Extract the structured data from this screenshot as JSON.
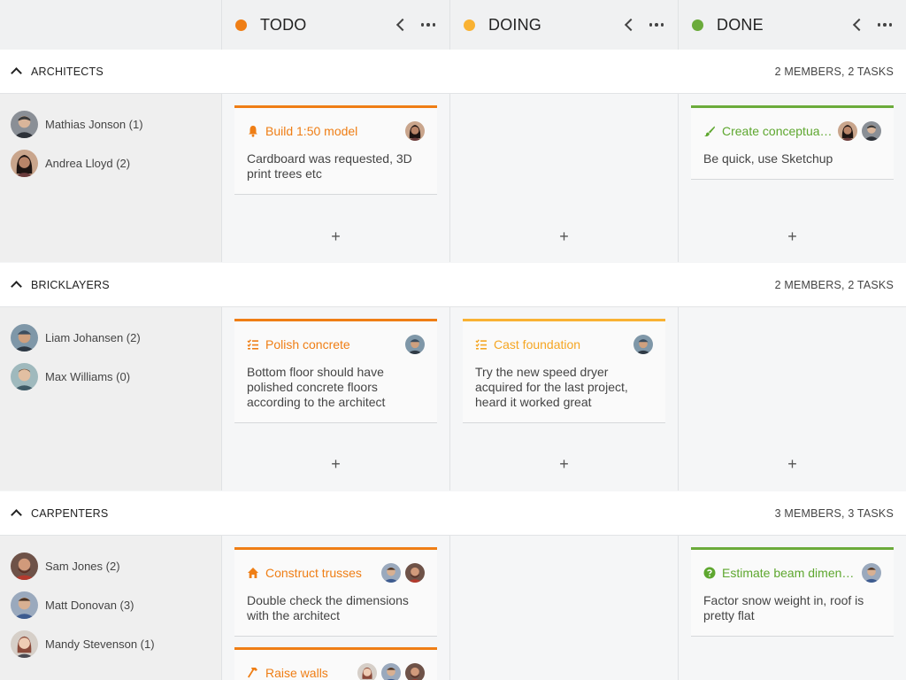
{
  "columns": [
    {
      "title": "TODO",
      "color": "#ef7e15"
    },
    {
      "title": "DOING",
      "color": "#f9b233"
    },
    {
      "title": "DONE",
      "color": "#6bab3b"
    }
  ],
  "groups": [
    {
      "name": "ARCHITECTS",
      "count": "2 MEMBERS, 2 TASKS",
      "members": [
        {
          "name": "Mathias Jonson (1)",
          "avatar": "man-grey"
        },
        {
          "name": "Andrea Lloyd (2)",
          "avatar": "woman-dark"
        }
      ],
      "cards": {
        "todo": [
          {
            "title": "Build 1:50 model",
            "icon": "bell-icon",
            "text": "Cardboard was requested, 3D print trees etc",
            "avatars": [
              "woman-dark"
            ]
          }
        ],
        "done": [
          {
            "title": "Create conceptual...",
            "icon": "brush-icon",
            "text": "Be quick, use Sketchup",
            "avatars": [
              "woman-dark",
              "man-grey"
            ]
          }
        ]
      }
    },
    {
      "name": "BRICKLAYERS",
      "count": "2 MEMBERS, 2 TASKS",
      "members": [
        {
          "name": "Liam Johansen (2)",
          "avatar": "man-cap"
        },
        {
          "name": "Max Williams (0)",
          "avatar": "man-young"
        }
      ],
      "cards": {
        "todo": [
          {
            "title": "Polish concrete",
            "icon": "checklist-icon",
            "text": "Bottom floor should have polished concrete floors according to the architect",
            "avatars": [
              "man-cap"
            ]
          }
        ],
        "doing": [
          {
            "title": "Cast foundation",
            "icon": "checklist-icon",
            "text": "Try the new speed dryer acquired for the last project, heard it worked great",
            "avatars": [
              "man-cap"
            ]
          }
        ]
      }
    },
    {
      "name": "CARPENTERS",
      "count": "3 MEMBERS, 3 TASKS",
      "members": [
        {
          "name": "Sam Jones (2)",
          "avatar": "man-red"
        },
        {
          "name": "Matt Donovan (3)",
          "avatar": "man-blue"
        },
        {
          "name": "Mandy Stevenson (1)",
          "avatar": "woman-light"
        }
      ],
      "cards": {
        "todo": [
          {
            "title": "Construct trusses",
            "icon": "house-icon",
            "text": "Double check the dimensions with the architect",
            "avatars": [
              "man-blue",
              "man-red"
            ]
          },
          {
            "title": "Raise walls",
            "icon": "hammer-icon",
            "text": "",
            "avatars": [
              "woman-light",
              "man-blue",
              "man-red"
            ]
          }
        ],
        "done": [
          {
            "title": "Estimate beam dimens...",
            "icon": "question-icon",
            "text": "Factor snow weight in, roof is pretty flat",
            "avatars": [
              "man-blue"
            ]
          }
        ]
      }
    }
  ],
  "add_label": "+"
}
